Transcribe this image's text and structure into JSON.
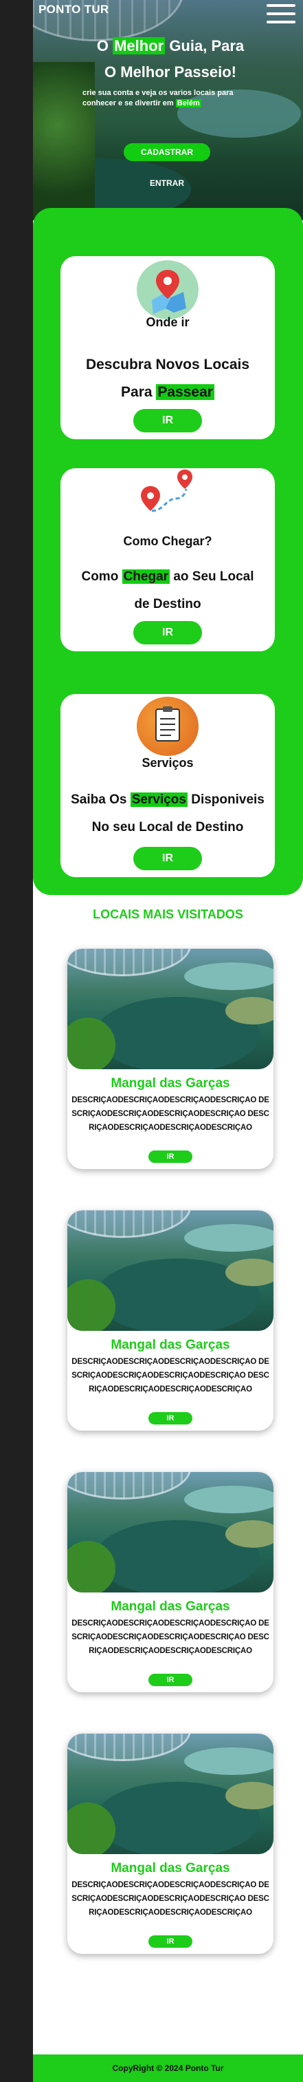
{
  "header": {
    "logo": "PONTO TUR",
    "menu_icon": "hamburger-menu-icon"
  },
  "hero": {
    "title_part1": "O ",
    "title_highlight": "Melhor",
    "title_part2": " Guia, Para",
    "title_line2": "O Melhor Passeio!",
    "subtitle_part1": "crie sua conta e veja os varios locais para conhecer e se divertir em ",
    "subtitle_highlight": "Belém",
    "register_label": "CADASTRAR",
    "login_label": "ENTRAR"
  },
  "cards": [
    {
      "icon": "map-pin-icon",
      "title": "Onde ir",
      "desc_line1": "Descubra Novos Locais",
      "desc_line2_pre": "Para ",
      "desc_line2_highlight": "Passear",
      "button": "IR"
    },
    {
      "icon": "route-icon",
      "title": "Como Chegar?",
      "desc_line1_pre": "Como ",
      "desc_line1_highlight": "Chegar",
      "desc_line1_post": " ao Seu Local",
      "desc_line2": "de Destino",
      "button": "IR"
    },
    {
      "icon": "clipboard-icon",
      "title": "Serviços",
      "desc_line1_pre": "Saiba Os ",
      "desc_line1_highlight": "Serviços",
      "desc_line1_post": " Disponiveis",
      "desc_line2": "No seu Local de Destino",
      "button": "IR"
    }
  ],
  "most_visited": {
    "title": "LOCAIS MAIS VISITADOS",
    "places": [
      {
        "name": "Mangal das Garças",
        "desc": "DESCRIÇAODESCRIÇAODESCRIÇAODESCRIÇAO DESCRIÇAODESCRIÇAODESCRIÇAODESCRIÇAO DESCRIÇAODESCRIÇAODESCRIÇAODESCRIÇAO",
        "button": "IR"
      },
      {
        "name": "Mangal das Garças",
        "desc": "DESCRIÇAODESCRIÇAODESCRIÇAODESCRIÇAO DESCRIÇAODESCRIÇAODESCRIÇAODESCRIÇAO DESCRIÇAODESCRIÇAODESCRIÇAODESCRIÇAO",
        "button": "IR"
      },
      {
        "name": "Mangal das Garças",
        "desc": "DESCRIÇAODESCRIÇAODESCRIÇAODESCRIÇAO DESCRIÇAODESCRIÇAODESCRIÇAODESCRIÇAO DESCRIÇAODESCRIÇAODESCRIÇAODESCRIÇAO",
        "button": "IR"
      },
      {
        "name": "Mangal das Garças",
        "desc": "DESCRIÇAODESCRIÇAODESCRIÇAODESCRIÇAO DESCRIÇAODESCRIÇAODESCRIÇAODESCRIÇAO DESCRIÇAODESCRIÇAODESCRIÇAODESCRIÇAO",
        "button": "IR"
      }
    ]
  },
  "footer": {
    "text": "CopyRight © 2024 Ponto Tur"
  },
  "colors": {
    "accent": "#1ecc1a",
    "rail": "#202020"
  }
}
